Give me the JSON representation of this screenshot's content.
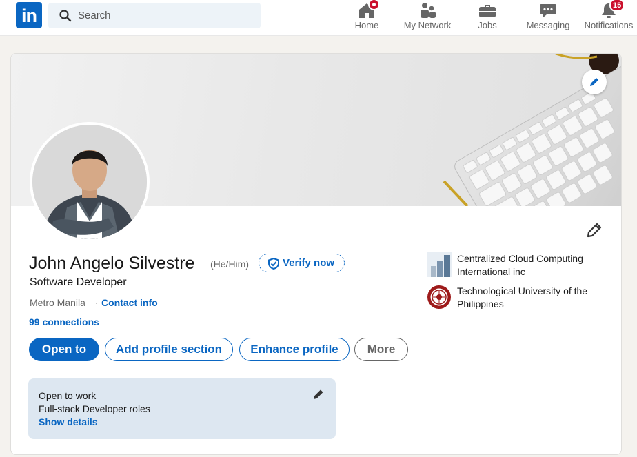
{
  "app": {
    "logo_text": "in"
  },
  "search": {
    "placeholder": "Search"
  },
  "nav": [
    {
      "label": "Home",
      "icon": "home-icon"
    },
    {
      "label": "My Network",
      "icon": "network-icon"
    },
    {
      "label": "Jobs",
      "icon": "briefcase-icon"
    },
    {
      "label": "Messaging",
      "icon": "messaging-icon"
    },
    {
      "label": "Notifications",
      "icon": "bell-icon",
      "badge": "15"
    }
  ],
  "profile": {
    "name": "John Angelo Silvestre",
    "pronouns": "(He/Him)",
    "verify_label": "Verify now",
    "headline": "Software Developer",
    "location": "Metro Manila",
    "separator": "·",
    "contact_label": "Contact info",
    "connections": "99 connections"
  },
  "actions": {
    "open_to": "Open to",
    "add_section": "Add profile section",
    "enhance": "Enhance profile",
    "more": "More"
  },
  "open_to_work": {
    "title": "Open to work",
    "roles": "Full-stack Developer roles",
    "details_label": "Show details"
  },
  "organizations": [
    {
      "name": "Centralized Cloud Computing International inc"
    },
    {
      "name": "Technological University of the Philippines"
    }
  ],
  "colors": {
    "brand": "#0a66c2",
    "badge": "#cb112d",
    "page_bg": "#f4f2ee",
    "open_to_work_bg": "#dde7f1"
  }
}
